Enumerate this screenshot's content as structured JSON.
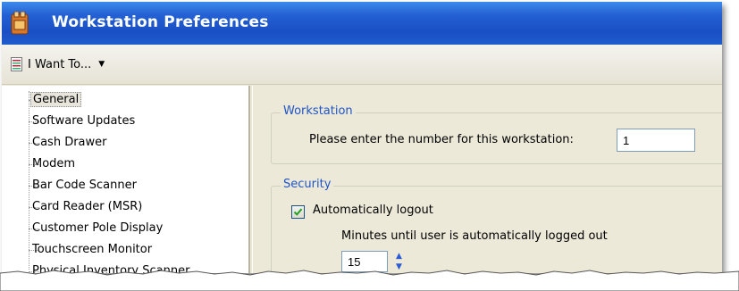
{
  "window": {
    "title": "Workstation Preferences"
  },
  "toolbar": {
    "i_want_label": "I Want To...",
    "caret": "▼"
  },
  "tree": {
    "items": [
      {
        "label": "General",
        "selected": true
      },
      {
        "label": "Software Updates"
      },
      {
        "label": "Cash Drawer"
      },
      {
        "label": "Modem"
      },
      {
        "label": "Bar Code Scanner"
      },
      {
        "label": "Card Reader (MSR)"
      },
      {
        "label": "Customer Pole Display"
      },
      {
        "label": "Touchscreen Monitor"
      },
      {
        "label": "Physical Inventory Scanner"
      }
    ]
  },
  "workstation": {
    "legend": "Workstation",
    "prompt": "Please enter the number for this workstation:",
    "number": "1"
  },
  "security": {
    "legend": "Security",
    "auto_logout_label": "Automatically logout",
    "auto_logout_checked": true,
    "minutes_label": "Minutes until user is automatically logged out",
    "minutes_value": "15"
  },
  "colors": {
    "title_bar": "#2461d4",
    "legend_text": "#1f55c6",
    "spin_arrow": "#2a5bd7"
  }
}
